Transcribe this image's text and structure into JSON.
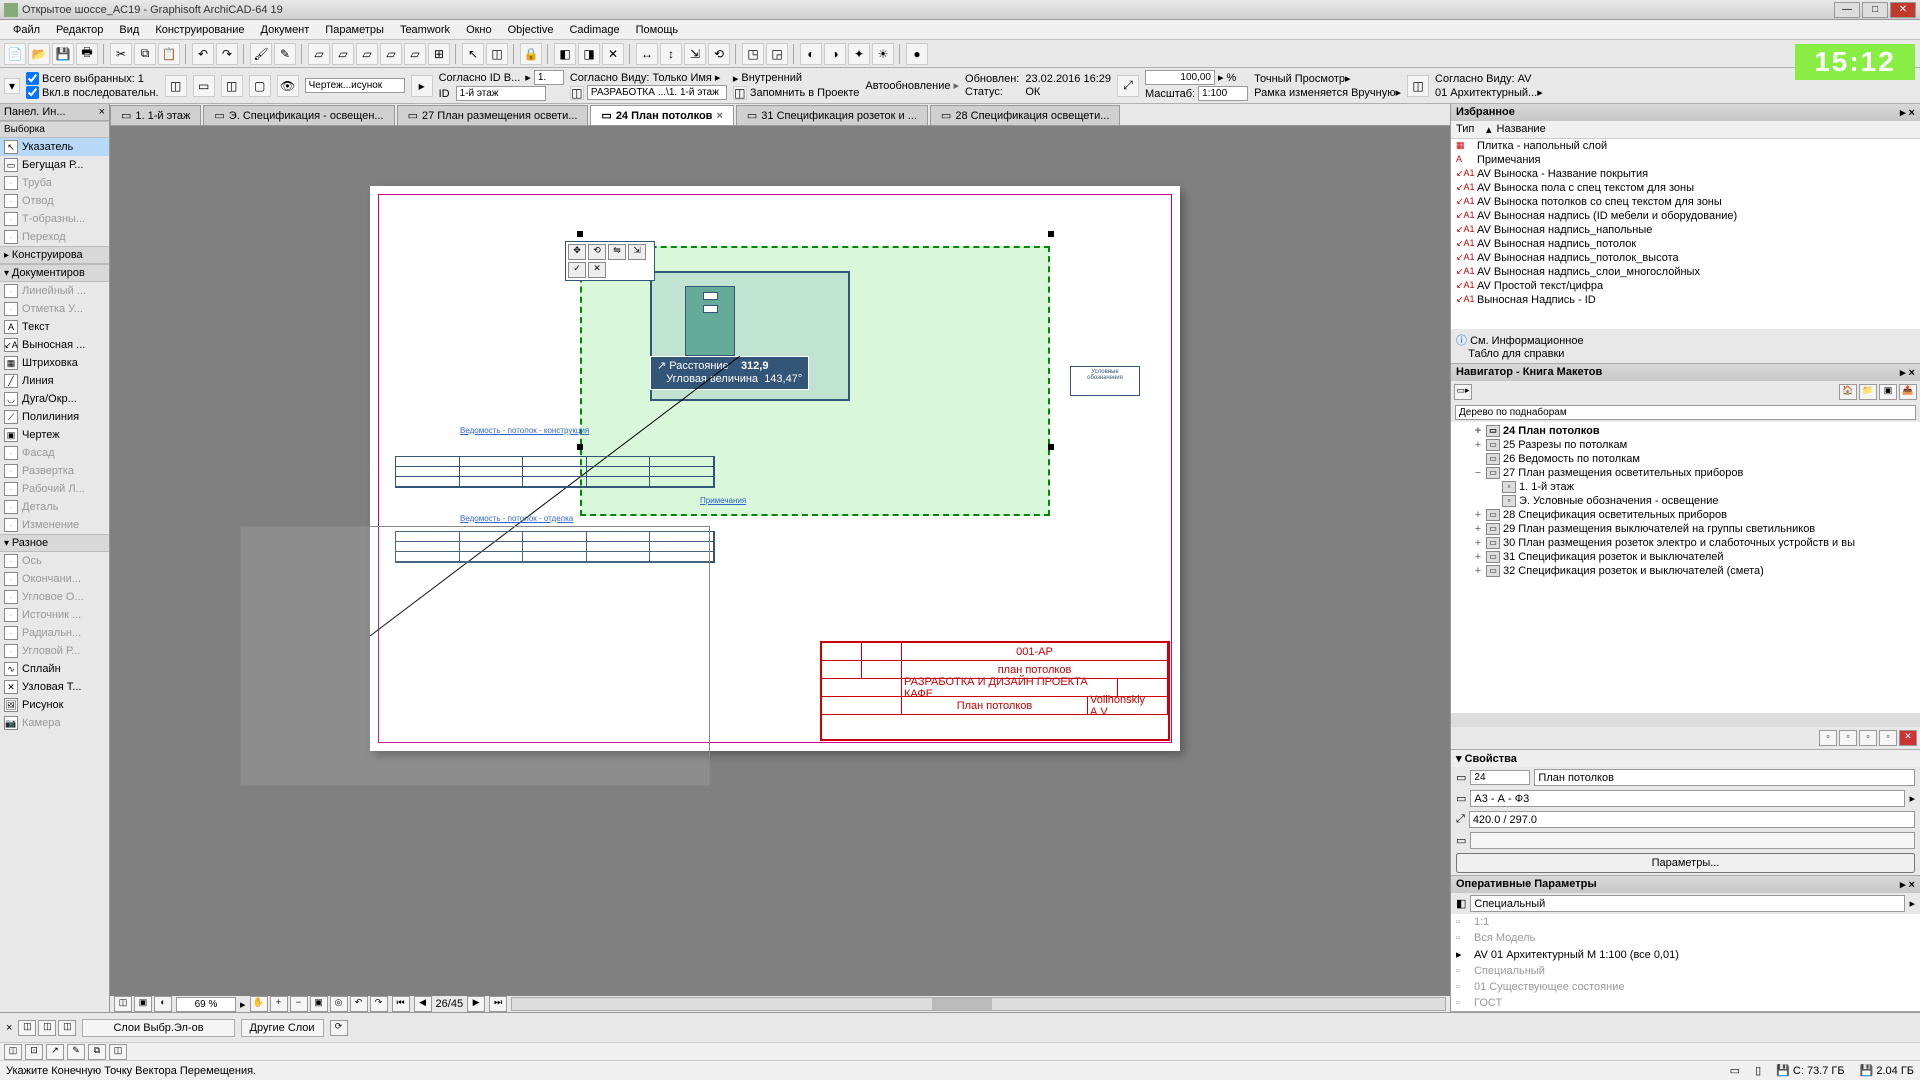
{
  "title": "Открытое шоссе_AC19 - Graphisoft ArchiCAD-64 19",
  "menu": [
    "Файл",
    "Редактор",
    "Вид",
    "Конструирование",
    "Документ",
    "Параметры",
    "Teamwork",
    "Окно",
    "Objective",
    "Cadimage",
    "Помощь"
  ],
  "options": {
    "selcount_label": "Всего выбранных:",
    "selcount": "1",
    "check1": "Вкл.в последовательн.",
    "drawing_link": "Чертеж...исунок",
    "id_label": "Согласно ID В...",
    "id_val": "1.",
    "id_sub": "ID",
    "floor": "1-й этаж",
    "view_label": "Согласно Виду: Только Имя",
    "src_label": "РАЗРАБОТКА ...\\1. 1-й этаж",
    "inner": "Внутренний",
    "store": "Запомнить в Проекте",
    "auto_label": "Автообновление",
    "updated_label": "Обновлен:",
    "updated": "23.02.2016 16:29",
    "status_label": "Статус:",
    "status": "ОК",
    "scale_percent": "100,00",
    "scale_label": "Масштаб:",
    "scale": "1:100",
    "preview_label": "Точный Просмотр",
    "frame_label": "Рамка изменяется Вручную",
    "viewpref_label": "Согласно Виду: AV",
    "viewpref_val": "01 Архитектурный..."
  },
  "clock": "15:12",
  "toolbox": {
    "header": "Панел. Ин...",
    "subheader": "Выборка",
    "arrow": "Указатель",
    "marquee": "Бегущая Р...",
    "tools_dim": [
      "Труба",
      "Отвод",
      "Т-образны...",
      "Переход"
    ],
    "group1": "Конструирова",
    "group2": "Документиров",
    "tools2_dim": [
      "Линейный ...",
      "Отметка У..."
    ],
    "text": "Текст",
    "label": "Выносная ...",
    "fill": "Штриховка",
    "line": "Линия",
    "arc": "Дуга/Окр...",
    "polyline": "Полилиния",
    "drawing": "Чертеж",
    "tools3_dim": [
      "Фасад",
      "Развертка",
      "Рабочий Л...",
      "Деталь",
      "Изменение"
    ],
    "group3": "Разное",
    "tools4_dim": [
      "Ось",
      "Окончани...",
      "Угловое О...",
      "Источник ...",
      "Радиальн...",
      "Угловой Р..."
    ],
    "spline": "Сплайн",
    "hotspot": "Узловая Т...",
    "figure": "Рисунок",
    "camera_dim": "Камера"
  },
  "tabs": [
    {
      "label": "1. 1-й этаж",
      "close": false
    },
    {
      "label": "Э. Спецификация - освещен...",
      "close": false
    },
    {
      "label": "27 План размещения освети...",
      "close": false
    },
    {
      "label": "24 План потолков",
      "close": true,
      "active": true
    },
    {
      "label": "31 Спецификация розеток и ...",
      "close": false
    },
    {
      "label": "28 Спецификация освещети...",
      "close": false
    }
  ],
  "tracker": {
    "dist_label": "Расстояние",
    "dist": "312,9",
    "ang_label": "Угловая величина",
    "ang": "143,47°"
  },
  "legend": "Условные обозначения",
  "link1": "Ведомость - потолок - конструкция",
  "link2": "Ведомость - потолок - отделка",
  "note": "Примечания",
  "titleblock": {
    "proj": "001-АР",
    "sheet_name": "план потолков",
    "company": "РАЗРАБОТКА И ДИЗАЙН ПРОЕКТА КАФЕ",
    "plan": "План потолков",
    "author": "Volihonskiy A.V"
  },
  "zoom": "69 %",
  "pages": "26/45",
  "favorites": {
    "header": "Избранное",
    "col1": "Тип",
    "col2": "Название",
    "items": [
      {
        "icon": "▦",
        "label": "Плитка - напольный слой"
      },
      {
        "icon": "A",
        "label": "Примечания"
      },
      {
        "icon": "↙A1",
        "label": "AV Выноска - Название покрытия"
      },
      {
        "icon": "↙A1",
        "label": "AV Выноска пола с спец текстом для зоны"
      },
      {
        "icon": "↙A1",
        "label": "AV Выноска потолков со спец текстом для зоны"
      },
      {
        "icon": "↙A1",
        "label": "AV Выносная надпись (ID мебели и оборудование)"
      },
      {
        "icon": "↙A1",
        "label": "AV Выносная надпись_напольные"
      },
      {
        "icon": "↙A1",
        "label": "AV Выносная надпись_потолок"
      },
      {
        "icon": "↙A1",
        "label": "AV Выносная надпись_потолок_высота"
      },
      {
        "icon": "↙A1",
        "label": "AV Выносная надпись_слои_многослойных"
      },
      {
        "icon": "↙A1",
        "label": "AV Простой текст/цифра"
      },
      {
        "icon": "↙A1",
        "label": "Выносная Надпись - ID"
      }
    ],
    "info_label": "См. Информационное",
    "info_sub": "Табло для справки"
  },
  "navigator": {
    "header": "Навигатор - Книга Макетов",
    "search": "Дерево по поднаборам",
    "tree": [
      {
        "indent": 1,
        "exp": "+",
        "icon": "▭",
        "label": "24 План потолков",
        "sel": true
      },
      {
        "indent": 1,
        "exp": "+",
        "icon": "▭",
        "label": "25 Разрезы по потолкам"
      },
      {
        "indent": 1,
        "exp": "",
        "icon": "▭",
        "label": "26 Ведомость по потолкам"
      },
      {
        "indent": 1,
        "exp": "−",
        "icon": "▭",
        "label": "27 План размещения осветительных приборов"
      },
      {
        "indent": 2,
        "exp": "",
        "icon": "▫",
        "label": "1. 1-й этаж"
      },
      {
        "indent": 2,
        "exp": "",
        "icon": "▫",
        "label": "Э. Условные обозначения - освещение"
      },
      {
        "indent": 1,
        "exp": "+",
        "icon": "▭",
        "label": "28 Спецификация осветительных приборов"
      },
      {
        "indent": 1,
        "exp": "+",
        "icon": "▭",
        "label": "29 План размещения выключателей на группы светильников"
      },
      {
        "indent": 1,
        "exp": "+",
        "icon": "▭",
        "label": "30 План размещения розеток электро и слаботочных устройств и вы"
      },
      {
        "indent": 1,
        "exp": "+",
        "icon": "▭",
        "label": "31 Спецификация розеток и выключателей"
      },
      {
        "indent": 1,
        "exp": "+",
        "icon": "▭",
        "label": "32 Спецификация розеток и выключателей (смета)"
      }
    ]
  },
  "props": {
    "header": "Свойства",
    "id": "24",
    "name": "План потолков",
    "format": "A3 - А - Ф3",
    "size": "420.0 / 297.0",
    "button": "Параметры..."
  },
  "quickopts": {
    "header": "Оперативные Параметры",
    "combo": "Специальный",
    "items": [
      "1:1",
      "Вся Модель",
      "AV 01 Архитектурный М 1:100 (все 0,01)",
      "Специальный",
      "01 Существующее состояние",
      "ГОСТ"
    ]
  },
  "layerbar": {
    "sel": "Слои Выбр.Эл-ов",
    "other": "Другие Слои"
  },
  "status": {
    "prompt": "Укажите Конечную Точку Вектора Перемещения.",
    "disk_c": "C: 73.7 ГБ",
    "disk_val": "2.04 ГБ"
  }
}
